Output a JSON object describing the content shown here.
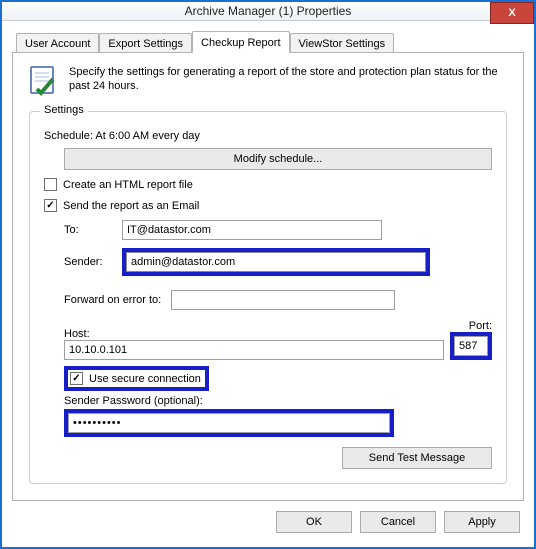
{
  "window": {
    "title": "Archive Manager (1) Properties",
    "close_label": "X"
  },
  "tabs": [
    {
      "label": "User Account",
      "active": false
    },
    {
      "label": "Export Settings",
      "active": false
    },
    {
      "label": "Checkup Report",
      "active": true
    },
    {
      "label": "ViewStor Settings",
      "active": false
    }
  ],
  "intro": "Specify the settings for generating a report of the store and protection plan status for the past 24 hours.",
  "settings": {
    "legend": "Settings",
    "schedule_label": "Schedule: At 6:00 AM every day",
    "modify_button": "Modify schedule...",
    "create_html_label": "Create an HTML report file",
    "create_html_checked": false,
    "send_email_label": "Send the report as an Email",
    "send_email_checked": true,
    "to_label": "To:",
    "to_value": "IT@datastor.com",
    "sender_label": "Sender:",
    "sender_value": "admin@datastor.com",
    "forward_label": "Forward on error to:",
    "forward_value": "",
    "host_label": "Host:",
    "host_value": "10.10.0.101",
    "port_label": "Port:",
    "port_value": "587",
    "secure_label": "Use secure connection",
    "secure_checked": true,
    "password_label": "Sender Password (optional):",
    "password_value": "••••••••••",
    "send_test_label": "Send Test Message"
  },
  "footer": {
    "ok": "OK",
    "cancel": "Cancel",
    "apply": "Apply"
  }
}
